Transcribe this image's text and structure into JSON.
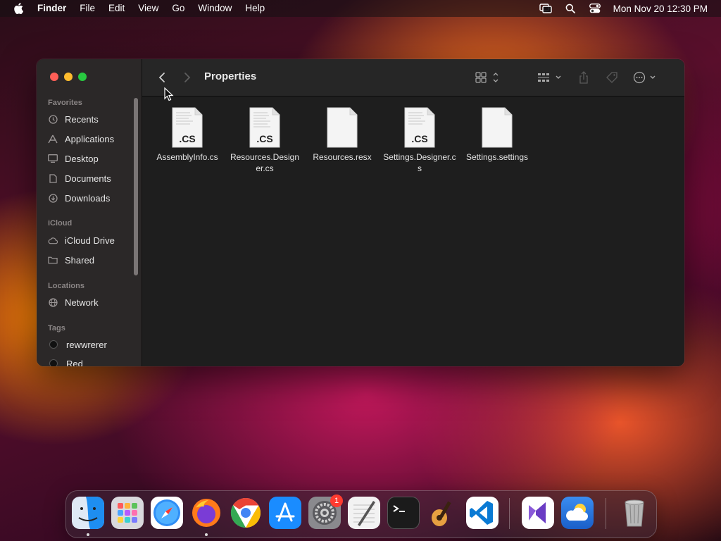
{
  "menubar": {
    "items": [
      "Finder",
      "File",
      "Edit",
      "View",
      "Go",
      "Window",
      "Help"
    ],
    "clock": "Mon Nov 20  12:30 PM",
    "icons": [
      "apple-icon",
      "screen-mirroring-icon",
      "spotlight-search-icon",
      "control-center-icon"
    ]
  },
  "finder": {
    "title": "Properties",
    "sidebar": {
      "favorites_label": "Favorites",
      "favorites": [
        {
          "label": "Recents",
          "icon": "clock-icon"
        },
        {
          "label": "Applications",
          "icon": "applications-icon"
        },
        {
          "label": "Desktop",
          "icon": "desktop-icon"
        },
        {
          "label": "Documents",
          "icon": "document-icon"
        },
        {
          "label": "Downloads",
          "icon": "download-icon"
        }
      ],
      "icloud_label": "iCloud",
      "icloud": [
        {
          "label": "iCloud Drive",
          "icon": "cloud-icon"
        },
        {
          "label": "Shared",
          "icon": "shared-folder-icon"
        }
      ],
      "locations_label": "Locations",
      "locations": [
        {
          "label": "Network",
          "icon": "globe-icon"
        }
      ],
      "tags_label": "Tags",
      "tags": [
        {
          "label": "rewwrerer",
          "color": "#111111"
        },
        {
          "label": "Red",
          "color": "#111111"
        }
      ]
    },
    "toolbar_icons": [
      "back-chevron-icon",
      "forward-chevron-icon",
      "icon-view-icon",
      "group-by-icon",
      "share-icon",
      "tag-icon",
      "more-actions-icon",
      "search-icon"
    ],
    "files": [
      {
        "name": "AssemblyInfo.cs",
        "ext": ".CS"
      },
      {
        "name": "Resources.Designer.cs",
        "ext": ".CS"
      },
      {
        "name": "Resources.resx",
        "ext": ""
      },
      {
        "name": "Settings.Designer.cs",
        "ext": ".CS"
      },
      {
        "name": "Settings.settings",
        "ext": ""
      }
    ]
  },
  "dock": {
    "apps": [
      "Finder",
      "Launchpad",
      "Safari",
      "Firefox",
      "Google Chrome",
      "App Store",
      "System Settings",
      "TextEdit",
      "Terminal",
      "GarageBand",
      "Visual Studio Code",
      "Visual Studio",
      "Weather",
      "Trash"
    ],
    "settings_badge": "1"
  },
  "colors": {
    "window_bg": "#1e1e1e",
    "sidebar_bg": "#2b2828",
    "close": "#ff5f57",
    "minimize": "#febc2e",
    "zoom": "#28c840",
    "badge": "#ff3b30"
  }
}
